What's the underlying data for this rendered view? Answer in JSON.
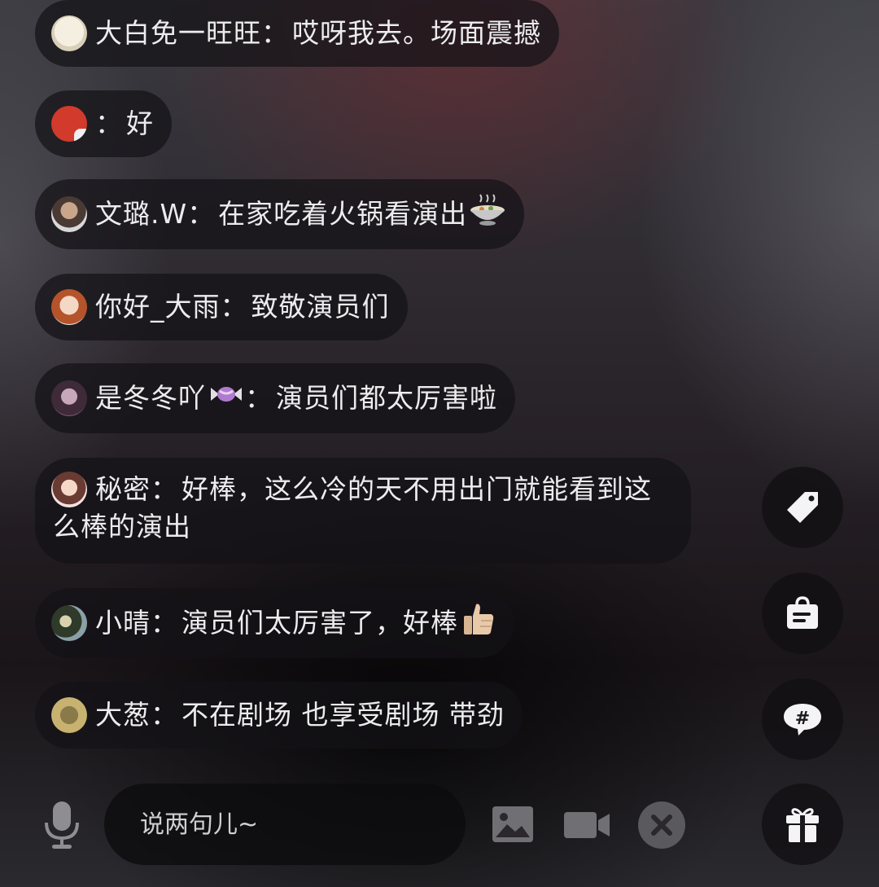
{
  "comments": [
    {
      "name": "大白免一旺旺",
      "sep": "：",
      "text": "哎呀我去。场面震撼"
    },
    {
      "name": "",
      "sep": "：",
      "text": "好"
    },
    {
      "name": "文璐.W",
      "sep": "：",
      "text": "在家吃着火锅看演出"
    },
    {
      "name": "你好_大雨",
      "sep": "：",
      "text": "致敬演员们"
    },
    {
      "name": "是冬冬吖",
      "sep": "：",
      "text": "演员们都太厉害啦"
    },
    {
      "name": "秘密",
      "sep": "：",
      "text_line1": "好棒，这么冷的天不用出门就能看到这",
      "text_line2": "么棒的演出"
    },
    {
      "name": "小晴",
      "sep": "：",
      "text": "演员们太厉害了，好棒"
    },
    {
      "name": "大葱",
      "sep": "：",
      "text": "不在剧场 也享受剧场 带劲"
    }
  ],
  "side_buttons": [
    "tag-icon",
    "shopping-bag-icon",
    "hashtag-chat-icon",
    "gift-icon"
  ],
  "input": {
    "placeholder": "说两句儿~"
  },
  "bottom_icons": [
    "microphone-icon",
    "image-icon",
    "video-camera-icon",
    "close-icon"
  ]
}
